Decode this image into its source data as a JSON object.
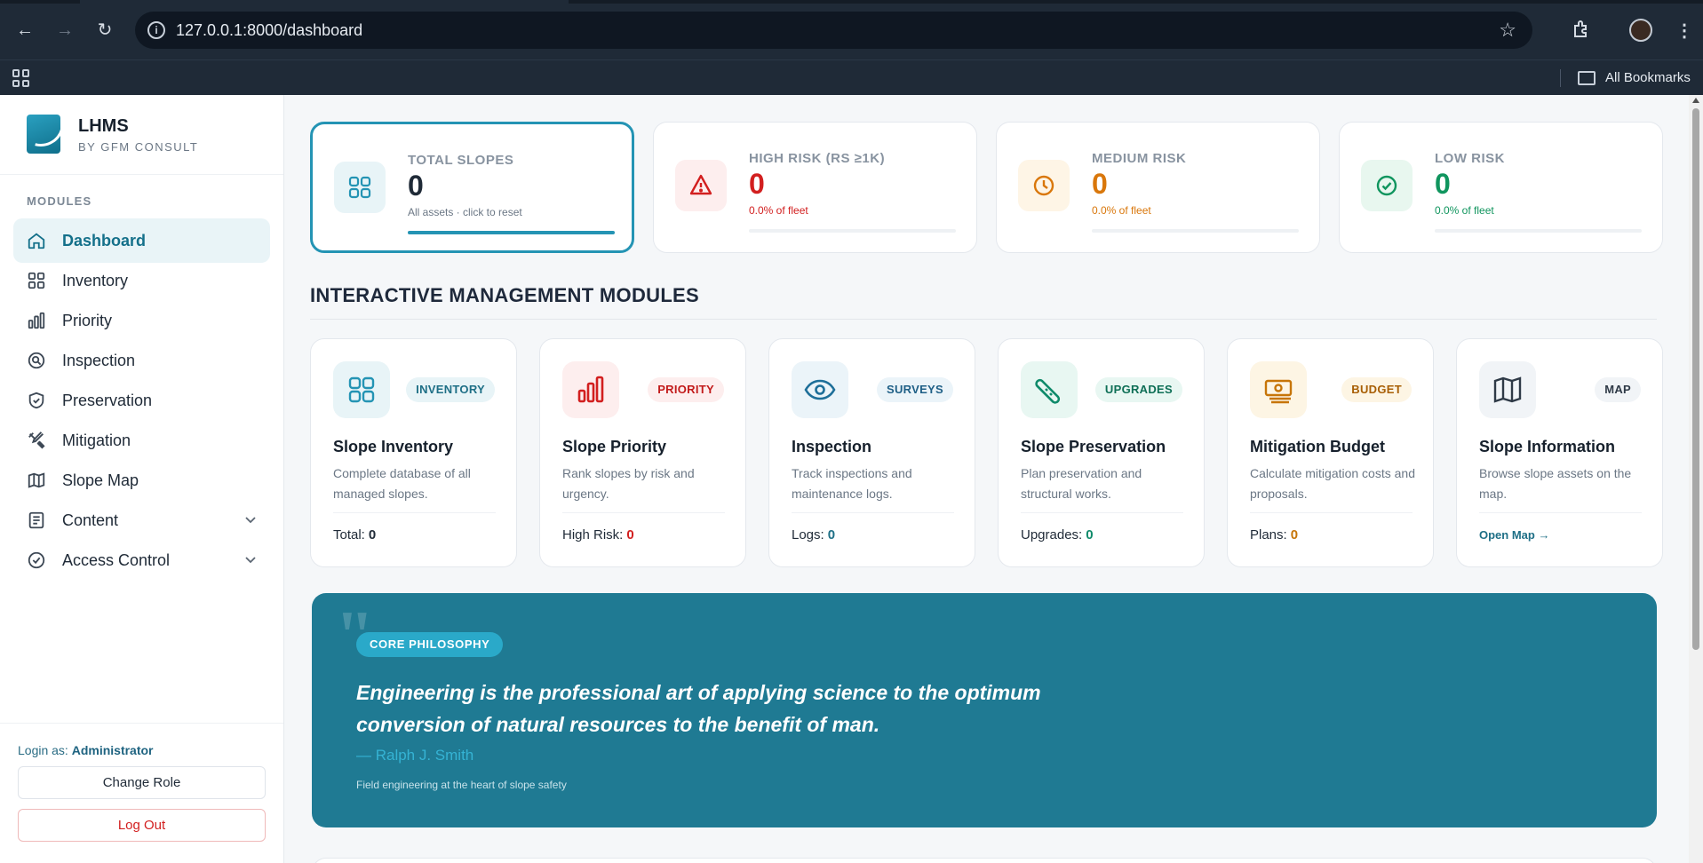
{
  "browser": {
    "url": "127.0.0.1:8000/dashboard",
    "bookmarks_label": "All Bookmarks"
  },
  "sidebar": {
    "brand_name": "LHMS",
    "brand_sub": "BY GFM CONSULT",
    "section_label": "MODULES",
    "items": [
      {
        "label": "Dashboard",
        "icon": "home-icon"
      },
      {
        "label": "Inventory",
        "icon": "grid-icon"
      },
      {
        "label": "Priority",
        "icon": "bar-chart-icon"
      },
      {
        "label": "Inspection",
        "icon": "search-icon"
      },
      {
        "label": "Preservation",
        "icon": "shield-icon"
      },
      {
        "label": "Mitigation",
        "icon": "tools-icon"
      },
      {
        "label": "Slope Map",
        "icon": "map-icon"
      },
      {
        "label": "Content",
        "icon": "document-icon"
      },
      {
        "label": "Access Control",
        "icon": "check-circle-icon"
      }
    ],
    "login_prefix": "Login as:",
    "login_role": "Administrator",
    "change_role_label": "Change Role",
    "logout_label": "Log Out"
  },
  "stats": [
    {
      "label": "TOTAL SLOPES",
      "value": "0",
      "sub": "All assets · click to reset",
      "color": "#1f2a37",
      "accent": "#2494b4",
      "fill": 1.0
    },
    {
      "label": "HIGH RISK (RS ≥1K)",
      "value": "0",
      "sub": "0.0% of fleet",
      "color": "#d21f1f",
      "accent": "#d21f1f",
      "fill": 0.0
    },
    {
      "label": "MEDIUM RISK",
      "value": "0",
      "sub": "0.0% of fleet",
      "color": "#d9770b",
      "accent": "#d9770b",
      "fill": 0.0
    },
    {
      "label": "LOW RISK",
      "value": "0",
      "sub": "0.0% of fleet",
      "color": "#10955e",
      "accent": "#10955e",
      "fill": 0.0
    }
  ],
  "section_title": "INTERACTIVE MANAGEMENT MODULES",
  "modules": [
    {
      "tag": "INVENTORY",
      "title": "Slope Inventory",
      "desc": "Complete database of all managed slopes.",
      "foot_label": "Total:",
      "foot_value": "0",
      "value_color": "#1f2a37"
    },
    {
      "tag": "PRIORITY",
      "title": "Slope Priority",
      "desc": "Rank slopes by risk and urgency.",
      "foot_label": "High Risk:",
      "foot_value": "0",
      "value_color": "#d21f1f"
    },
    {
      "tag": "SURVEYS",
      "title": "Inspection",
      "desc": "Track inspections and maintenance logs.",
      "foot_label": "Logs:",
      "foot_value": "0",
      "value_color": "#1e6f86"
    },
    {
      "tag": "UPGRADES",
      "title": "Slope Preservation",
      "desc": "Plan preservation and structural works.",
      "foot_label": "Upgrades:",
      "foot_value": "0",
      "value_color": "#0f8a6a"
    },
    {
      "tag": "BUDGET",
      "title": "Mitigation Budget",
      "desc": "Calculate mitigation costs and proposals.",
      "foot_label": "Plans:",
      "foot_value": "0",
      "value_color": "#c77508"
    },
    {
      "tag": "MAP",
      "title": "Slope Information",
      "desc": "Browse slope assets on the map.",
      "link": "Open Map →"
    }
  ],
  "philosophy": {
    "tag": "CORE PHILOSOPHY",
    "quote": "Engineering is the professional art of applying science to the optimum conversion of natural resources to the benefit of man.",
    "author": "— Ralph J. Smith",
    "note": "Field engineering at the heart of slope safety"
  }
}
